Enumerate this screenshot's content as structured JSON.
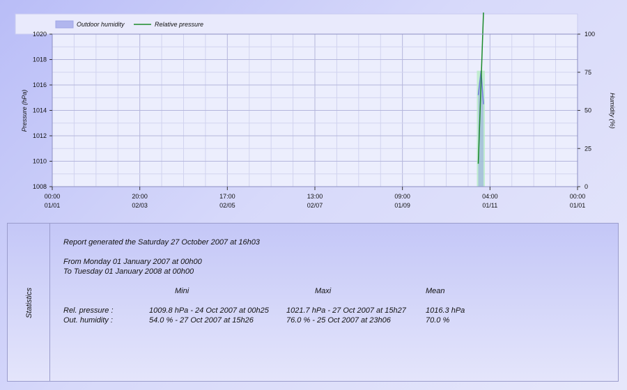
{
  "chart_data": {
    "type": "line",
    "title": "",
    "xlabel": "",
    "ylabel": "Pressure  (hPa)",
    "y2label": "Humidity  (%)",
    "ylim": [
      1008,
      1020
    ],
    "y2lim": [
      0,
      100
    ],
    "x_ticks": [
      {
        "time": "00:00",
        "date": "01/01"
      },
      {
        "time": "20:00",
        "date": "02/03"
      },
      {
        "time": "17:00",
        "date": "02/05"
      },
      {
        "time": "13:00",
        "date": "02/07"
      },
      {
        "time": "09:00",
        "date": "01/09"
      },
      {
        "time": "04:00",
        "date": "01/11"
      },
      {
        "time": "00:00",
        "date": "01/01"
      }
    ],
    "y_ticks": [
      1008,
      1010,
      1012,
      1014,
      1016,
      1018,
      1020
    ],
    "y2_ticks": [
      0,
      25,
      50,
      75,
      100
    ],
    "grid": true,
    "legend_position": "top-left",
    "series": [
      {
        "name": "Outdoor humidity",
        "axis": "right",
        "style": "area",
        "color": "#8c95e6",
        "x": [
          "2007-10-24 00:00",
          "2007-10-25 23:06",
          "2007-10-27 15:26"
        ],
        "values": [
          60,
          76,
          54
        ]
      },
      {
        "name": "Relative pressure",
        "axis": "left",
        "style": "line",
        "color": "#1a8a2a",
        "x": [
          "2007-10-24 00:25",
          "2007-10-27 15:27"
        ],
        "values": [
          1009.8,
          1021.7
        ]
      }
    ]
  },
  "stats": {
    "side_label": "Statistics",
    "report_line": "Report generated the Saturday 27 October 2007 at 16h03",
    "from_line": "From Monday 01 January 2007 at 00h00",
    "to_line": "To Tuesday 01 January 2008 at 00h00",
    "headers": [
      "Mini",
      "Maxi",
      "Mean"
    ],
    "rows": [
      {
        "label": "Rel. pressure :",
        "mini": "1009.8 hPa - 24 Oct 2007 at 00h25",
        "maxi": "1021.7 hPa - 27 Oct 2007 at 15h27",
        "mean": "1016.3 hPa"
      },
      {
        "label": "Out. humidity :",
        "mini": "54.0 % - 27 Oct 2007 at 15h26",
        "maxi": "76.0 % - 25 Oct 2007 at 23h06",
        "mean": "70.0 %"
      }
    ]
  }
}
